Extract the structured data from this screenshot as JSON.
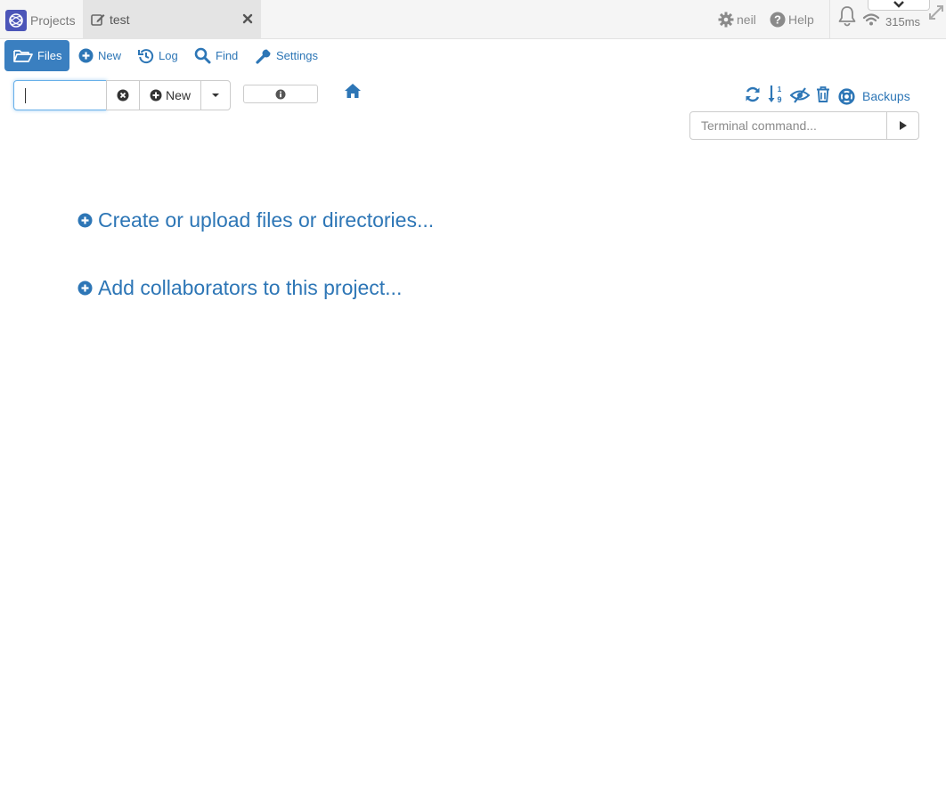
{
  "topbar": {
    "projects_label": "Projects",
    "tab_title": "test",
    "user_label": "neil",
    "help_label": "Help",
    "ping": "315ms"
  },
  "nav": {
    "files": "Files",
    "new": "New",
    "log": "Log",
    "find": "Find",
    "settings": "Settings"
  },
  "toolbar": {
    "search_value": "",
    "new_label": "New",
    "backups_label": "Backups",
    "terminal_placeholder": "Terminal command..."
  },
  "main": {
    "create_link": "Create or upload files or directories...",
    "collab_link": "Add collaborators to this project..."
  },
  "colors": {
    "accent": "#2d76b6",
    "active_tab": "#3a7fc0",
    "logo": "#4b55b8"
  },
  "icons": [
    "logo-icon",
    "edit-icon",
    "close-icon",
    "gear-icon",
    "question-circle-icon",
    "bell-icon",
    "wifi-icon",
    "chevron-down-icon",
    "expand-icon",
    "folder-open-icon",
    "plus-circle-icon",
    "history-icon",
    "search-icon",
    "wrench-icon",
    "times-circle-icon",
    "caret-down-icon",
    "info-icon",
    "home-icon",
    "refresh-icon",
    "sort-numeric-icon",
    "eye-slash-icon",
    "trash-icon",
    "life-ring-icon",
    "play-icon"
  ]
}
